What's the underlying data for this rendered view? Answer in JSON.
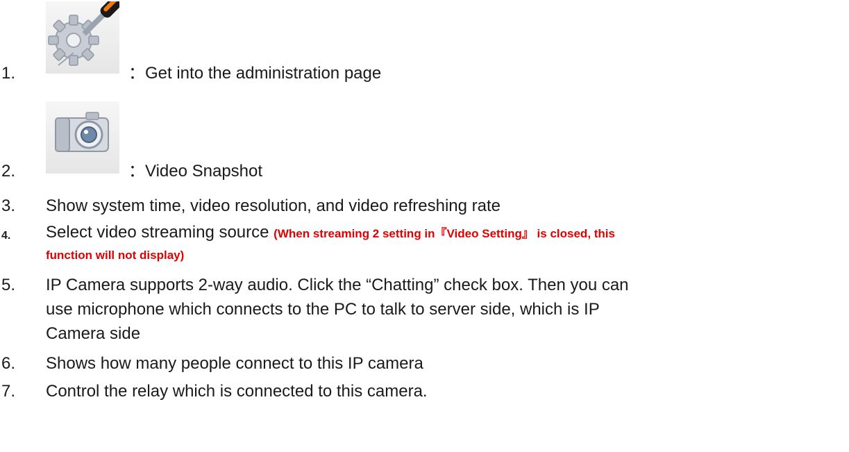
{
  "items": [
    {
      "num": "1.",
      "text": "：Get into the administration page",
      "icon": "admin-tools-icon"
    },
    {
      "num": "2.",
      "text": "：Video Snapshot",
      "icon": "camera-snapshot-icon"
    },
    {
      "num": "3.",
      "text": "Show system time, video resolution, and video refreshing rate"
    },
    {
      "num": "4.",
      "text": "Select video streaming source ",
      "note_line1": "(When streaming 2 setting in『Video Setting』 is closed, this",
      "note_line2": "function will not display)"
    },
    {
      "num": "5.",
      "lines": [
        "IP Camera supports 2-way audio. Click the “Chatting” check box. Then you can",
        "use microphone which connects to the PC to talk to server side, which is IP",
        "Camera side"
      ]
    },
    {
      "num": "6.",
      "text": "Shows how many people connect to this IP camera"
    },
    {
      "num": "7.",
      "text": "Control the relay which is connected to this camera."
    }
  ],
  "colors": {
    "note": "#e00000",
    "text": "#1a1a1a"
  }
}
